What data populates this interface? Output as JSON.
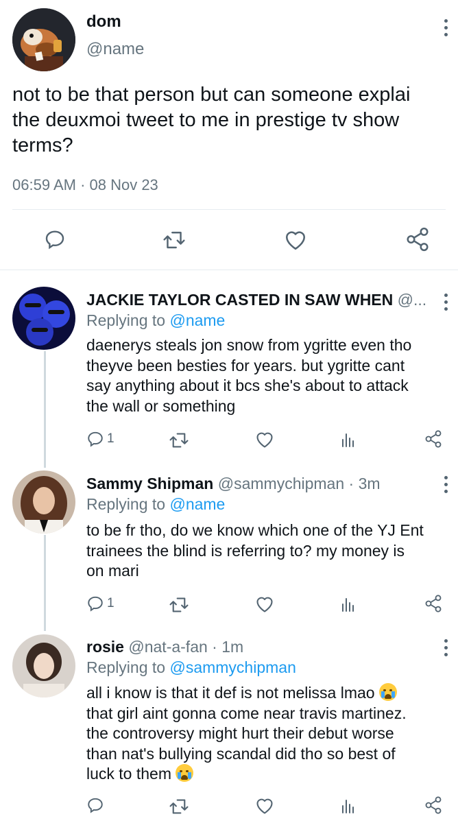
{
  "main_tweet": {
    "name": "dom",
    "handle": "@name",
    "text_lines": [
      "not to be that person but can someone explai",
      "the deuxmoi tweet  to me in prestige tv show",
      "terms?"
    ],
    "timestamp": "06:59 AM · 08 Nov 23",
    "icons": [
      "reply-icon",
      "retweet-icon",
      "like-icon",
      "share-icon"
    ]
  },
  "replies": [
    {
      "name": "JACKIE TAYLOR CASTED IN SAW WHEN",
      "handle_meta": "@...",
      "replying_prefix": "Replying to",
      "replying_to": "@name",
      "text_lines": [
        "daenerys steals jon snow from ygritte even tho",
        "theyve been besties for years. but ygritte cant",
        "say anything about it bcs she's about to attack",
        "the wall or something"
      ],
      "reply_count": "1"
    },
    {
      "name": "Sammy Shipman",
      "handle_meta": "@sammychipman · 3m",
      "replying_prefix": "Replying to",
      "replying_to": "@name",
      "text_lines": [
        "to be fr tho, do we know which one of the YJ Ent",
        "trainees the blind is referring to? my money is",
        "on mari"
      ],
      "reply_count": "1"
    },
    {
      "name": "rosie",
      "handle_meta": "@nat-a-fan · 1m",
      "replying_prefix": "Replying to",
      "replying_to": "@sammychipman",
      "text_lines": [
        "all i know is that it def is not melissa lmao",
        "that girl aint gonna come near travis martinez.",
        "the controversy might hurt their debut worse",
        "than nat's bullying scandal did tho so best of",
        "luck to them"
      ],
      "reply_count": ""
    }
  ],
  "colors": {
    "accent": "#1d9bf0",
    "muted": "#66757f",
    "icon": "#536471",
    "divider": "#e6ecf0"
  }
}
